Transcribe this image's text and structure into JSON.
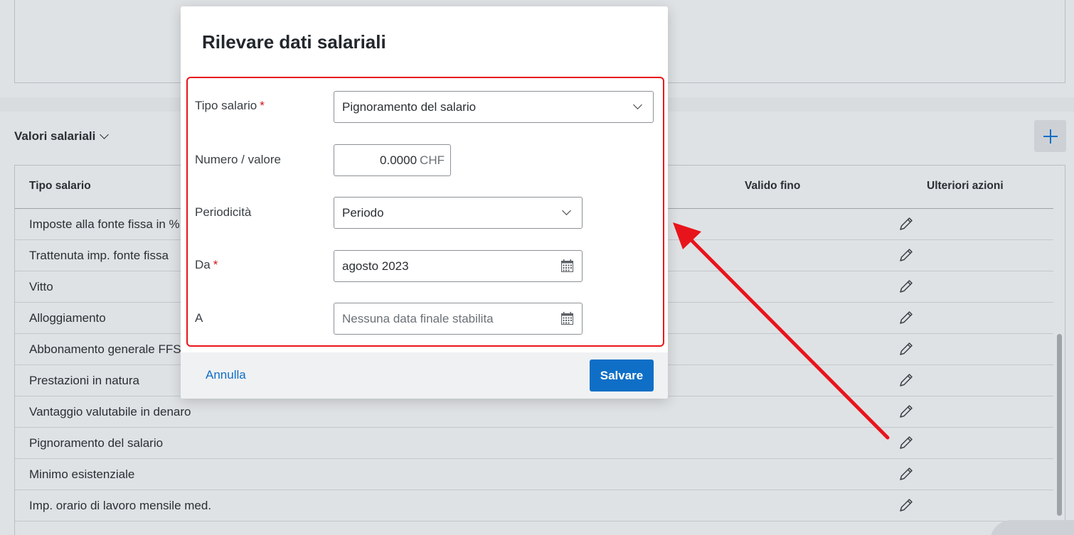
{
  "background": {
    "section_title": "Valori salariali",
    "table": {
      "columns": [
        "Tipo salario",
        "Valido fino",
        "Ulteriori azioni"
      ],
      "rows": [
        "Imposte alla fonte fissa in %",
        "Trattenuta imp. fonte fissa",
        "Vitto",
        "Alloggiamento",
        "Abbonamento generale FFS",
        "Prestazioni in natura",
        "Vantaggio valutabile in denaro",
        "Pignoramento del salario",
        "Minimo esistenziale",
        "Imp. orario di lavoro mensile med."
      ]
    }
  },
  "modal": {
    "title": "Rilevare dati salariali",
    "fields": {
      "tipo_salario": {
        "label": "Tipo salario",
        "required_mark": "*",
        "value": "Pignoramento del salario"
      },
      "numero_valore": {
        "label": "Numero / valore",
        "value": "0.0000",
        "unit": "CHF"
      },
      "periodicita": {
        "label": "Periodicità",
        "value": "Periodo"
      },
      "da": {
        "label": "Da",
        "required_mark": "*",
        "value": "agosto 2023"
      },
      "a": {
        "label": "A",
        "placeholder": "Nessuna data finale stabilita"
      }
    },
    "footer": {
      "cancel_label": "Annulla",
      "save_label": "Salvare"
    }
  },
  "colors": {
    "accent": "#0f6fc6",
    "annotation": "#e8141b",
    "required": "#d0151b"
  },
  "icons": [
    "chevron-down-icon",
    "plus-icon",
    "pencil-icon",
    "calendar-icon",
    "arrow-annotation"
  ]
}
